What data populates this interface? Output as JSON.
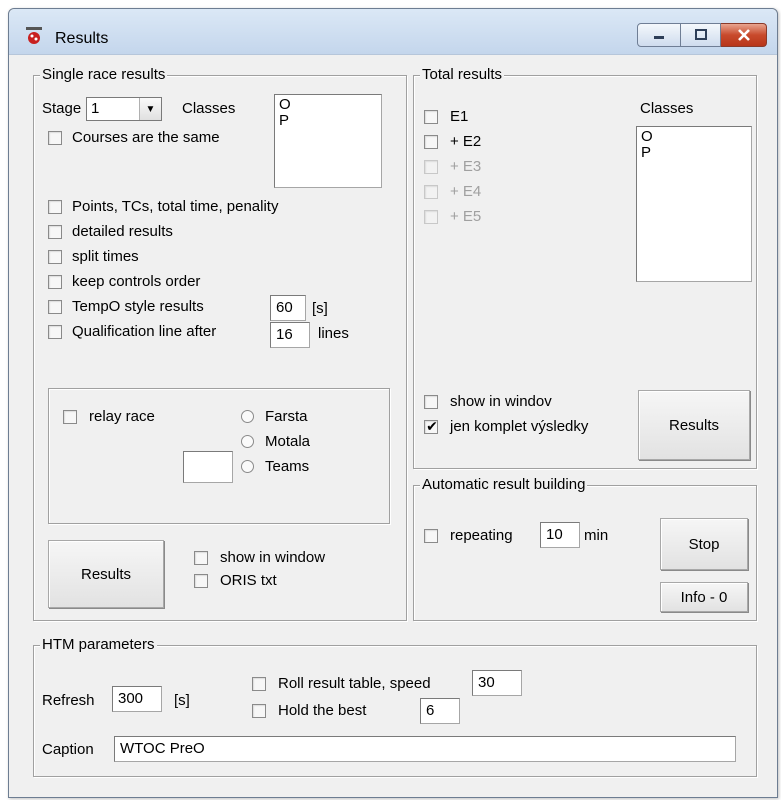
{
  "window": {
    "title": "Results"
  },
  "single_race": {
    "caption": "Single race results",
    "stage_label": "Stage",
    "stage_value": "1",
    "classes_label": "Classes",
    "classes": [
      "O",
      "P"
    ],
    "courses_same": {
      "label": "Courses are the same",
      "checked": false
    },
    "options": [
      {
        "label": "Points, TCs, total time, penality",
        "checked": false
      },
      {
        "label": "detailed results",
        "checked": false
      },
      {
        "label": "split times",
        "checked": false
      },
      {
        "label": "keep controls order",
        "checked": false
      }
    ],
    "tempo": {
      "label": "TempO style results",
      "value": "60",
      "unit": "[s]",
      "checked": false
    },
    "qualification": {
      "label": "Qualification line after",
      "value": "16",
      "unit": "lines",
      "checked": false
    },
    "relay": {
      "label": "relay race",
      "checked": false,
      "radios": [
        "Farsta",
        "Motala",
        "Teams"
      ],
      "teams_value": ""
    },
    "results_button": "Results",
    "show_in_window": "show in window",
    "oris_txt": "ORIS txt"
  },
  "total_results": {
    "caption": "Total results",
    "stages": [
      {
        "label": "E1",
        "enabled": true,
        "checked": false
      },
      {
        "label": "+ E2",
        "enabled": true,
        "checked": false
      },
      {
        "label": "+ E3",
        "enabled": false,
        "checked": false
      },
      {
        "label": "+ E4",
        "enabled": false,
        "checked": false
      },
      {
        "label": "+ E5",
        "enabled": false,
        "checked": false
      }
    ],
    "classes_label": "Classes",
    "classes": [
      "O",
      "P"
    ],
    "show_in_window": {
      "label": "show in windov",
      "checked": false
    },
    "complete_only": {
      "label": "jen komplet výsledky",
      "checked": true
    },
    "results_button": "Results"
  },
  "auto_build": {
    "caption": "Automatic result building",
    "repeating_label": "repeating",
    "repeating_value": "10",
    "unit": "min",
    "stop_button": "Stop",
    "info_button": "Info - 0"
  },
  "htm": {
    "caption": "HTM parameters",
    "refresh_label": "Refresh",
    "refresh_value": "300",
    "refresh_unit": "[s]",
    "roll_label": "Roll result table, speed",
    "roll_value": "30",
    "hold_label": "Hold the best",
    "hold_value": "6",
    "caption_label": "Caption",
    "caption_value": "WTOC PreO"
  },
  "colors": {
    "titlebar": "#c4d6ec",
    "close": "#c84a2c",
    "dialog": "#f0f0f0"
  }
}
